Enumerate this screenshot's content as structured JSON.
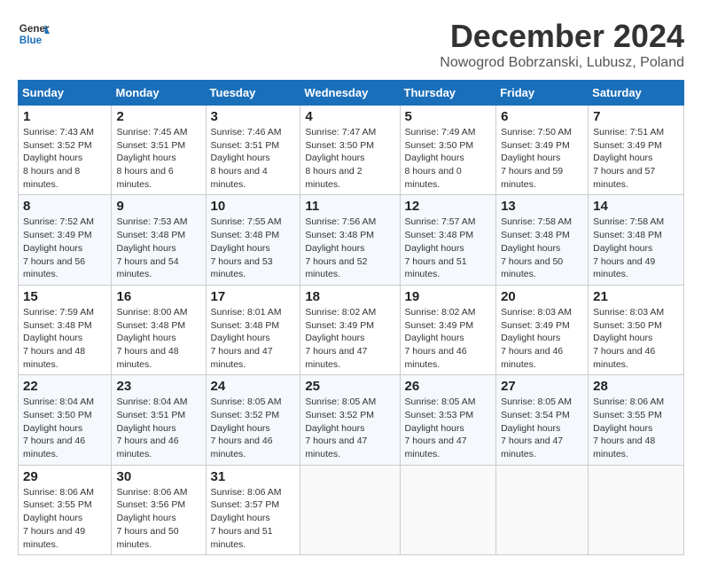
{
  "header": {
    "logo_line1": "General",
    "logo_line2": "Blue",
    "month": "December 2024",
    "location": "Nowogrod Bobrzanski, Lubusz, Poland"
  },
  "weekdays": [
    "Sunday",
    "Monday",
    "Tuesday",
    "Wednesday",
    "Thursday",
    "Friday",
    "Saturday"
  ],
  "weeks": [
    [
      {
        "day": "1",
        "sunrise": "7:43 AM",
        "sunset": "3:52 PM",
        "daylight": "8 hours and 8 minutes."
      },
      {
        "day": "2",
        "sunrise": "7:45 AM",
        "sunset": "3:51 PM",
        "daylight": "8 hours and 6 minutes."
      },
      {
        "day": "3",
        "sunrise": "7:46 AM",
        "sunset": "3:51 PM",
        "daylight": "8 hours and 4 minutes."
      },
      {
        "day": "4",
        "sunrise": "7:47 AM",
        "sunset": "3:50 PM",
        "daylight": "8 hours and 2 minutes."
      },
      {
        "day": "5",
        "sunrise": "7:49 AM",
        "sunset": "3:50 PM",
        "daylight": "8 hours and 0 minutes."
      },
      {
        "day": "6",
        "sunrise": "7:50 AM",
        "sunset": "3:49 PM",
        "daylight": "7 hours and 59 minutes."
      },
      {
        "day": "7",
        "sunrise": "7:51 AM",
        "sunset": "3:49 PM",
        "daylight": "7 hours and 57 minutes."
      }
    ],
    [
      {
        "day": "8",
        "sunrise": "7:52 AM",
        "sunset": "3:49 PM",
        "daylight": "7 hours and 56 minutes."
      },
      {
        "day": "9",
        "sunrise": "7:53 AM",
        "sunset": "3:48 PM",
        "daylight": "7 hours and 54 minutes."
      },
      {
        "day": "10",
        "sunrise": "7:55 AM",
        "sunset": "3:48 PM",
        "daylight": "7 hours and 53 minutes."
      },
      {
        "day": "11",
        "sunrise": "7:56 AM",
        "sunset": "3:48 PM",
        "daylight": "7 hours and 52 minutes."
      },
      {
        "day": "12",
        "sunrise": "7:57 AM",
        "sunset": "3:48 PM",
        "daylight": "7 hours and 51 minutes."
      },
      {
        "day": "13",
        "sunrise": "7:58 AM",
        "sunset": "3:48 PM",
        "daylight": "7 hours and 50 minutes."
      },
      {
        "day": "14",
        "sunrise": "7:58 AM",
        "sunset": "3:48 PM",
        "daylight": "7 hours and 49 minutes."
      }
    ],
    [
      {
        "day": "15",
        "sunrise": "7:59 AM",
        "sunset": "3:48 PM",
        "daylight": "7 hours and 48 minutes."
      },
      {
        "day": "16",
        "sunrise": "8:00 AM",
        "sunset": "3:48 PM",
        "daylight": "7 hours and 48 minutes."
      },
      {
        "day": "17",
        "sunrise": "8:01 AM",
        "sunset": "3:48 PM",
        "daylight": "7 hours and 47 minutes."
      },
      {
        "day": "18",
        "sunrise": "8:02 AM",
        "sunset": "3:49 PM",
        "daylight": "7 hours and 47 minutes."
      },
      {
        "day": "19",
        "sunrise": "8:02 AM",
        "sunset": "3:49 PM",
        "daylight": "7 hours and 46 minutes."
      },
      {
        "day": "20",
        "sunrise": "8:03 AM",
        "sunset": "3:49 PM",
        "daylight": "7 hours and 46 minutes."
      },
      {
        "day": "21",
        "sunrise": "8:03 AM",
        "sunset": "3:50 PM",
        "daylight": "7 hours and 46 minutes."
      }
    ],
    [
      {
        "day": "22",
        "sunrise": "8:04 AM",
        "sunset": "3:50 PM",
        "daylight": "7 hours and 46 minutes."
      },
      {
        "day": "23",
        "sunrise": "8:04 AM",
        "sunset": "3:51 PM",
        "daylight": "7 hours and 46 minutes."
      },
      {
        "day": "24",
        "sunrise": "8:05 AM",
        "sunset": "3:52 PM",
        "daylight": "7 hours and 46 minutes."
      },
      {
        "day": "25",
        "sunrise": "8:05 AM",
        "sunset": "3:52 PM",
        "daylight": "7 hours and 47 minutes."
      },
      {
        "day": "26",
        "sunrise": "8:05 AM",
        "sunset": "3:53 PM",
        "daylight": "7 hours and 47 minutes."
      },
      {
        "day": "27",
        "sunrise": "8:05 AM",
        "sunset": "3:54 PM",
        "daylight": "7 hours and 47 minutes."
      },
      {
        "day": "28",
        "sunrise": "8:06 AM",
        "sunset": "3:55 PM",
        "daylight": "7 hours and 48 minutes."
      }
    ],
    [
      {
        "day": "29",
        "sunrise": "8:06 AM",
        "sunset": "3:55 PM",
        "daylight": "7 hours and 49 minutes."
      },
      {
        "day": "30",
        "sunrise": "8:06 AM",
        "sunset": "3:56 PM",
        "daylight": "7 hours and 50 minutes."
      },
      {
        "day": "31",
        "sunrise": "8:06 AM",
        "sunset": "3:57 PM",
        "daylight": "7 hours and 51 minutes."
      },
      null,
      null,
      null,
      null
    ]
  ]
}
